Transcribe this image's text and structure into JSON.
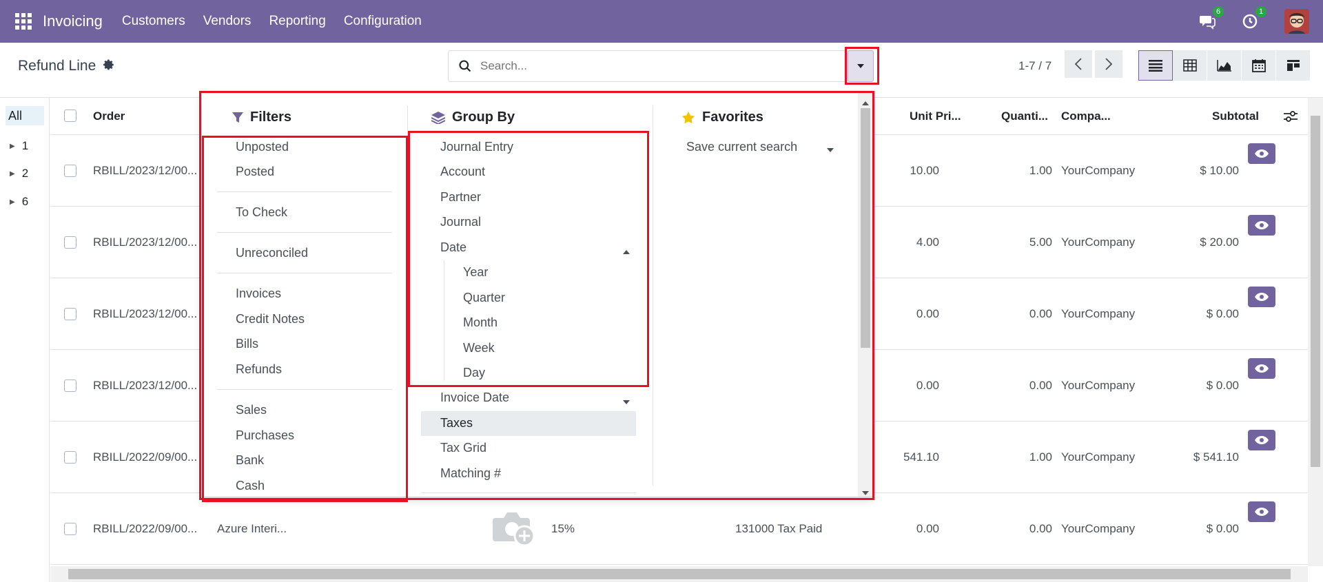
{
  "navbar": {
    "app_name": "Invoicing",
    "menu": [
      "Customers",
      "Vendors",
      "Reporting",
      "Configuration"
    ],
    "messages_badge": "6",
    "activities_badge": "1"
  },
  "control": {
    "title": "Refund Line",
    "search_placeholder": "Search...",
    "pager": "1-7 / 7"
  },
  "groups": {
    "all_label": "All",
    "items": [
      "1",
      "2",
      "6"
    ]
  },
  "table": {
    "headers": {
      "order": "Order",
      "unit_price": "Unit Pri...",
      "quantity": "Quanti...",
      "company": "Compa...",
      "subtotal": "Subtotal"
    },
    "rows": [
      {
        "order": "RBILL/2023/12/00...",
        "partner": "",
        "discount": "",
        "tax": "",
        "unit_price": "10.00",
        "quantity": "1.00",
        "company": "YourCompany",
        "subtotal": "$ 10.00"
      },
      {
        "order": "RBILL/2023/12/00...",
        "partner": "",
        "discount": "",
        "tax": "",
        "unit_price": "4.00",
        "quantity": "5.00",
        "company": "YourCompany",
        "subtotal": "$ 20.00"
      },
      {
        "order": "RBILL/2023/12/00...",
        "partner": "",
        "discount": "",
        "tax": "",
        "unit_price": "0.00",
        "quantity": "0.00",
        "company": "YourCompany",
        "subtotal": "$ 0.00"
      },
      {
        "order": "RBILL/2023/12/00...",
        "partner": "",
        "discount": "",
        "tax": "",
        "unit_price": "0.00",
        "quantity": "0.00",
        "company": "YourCompany",
        "subtotal": "$ 0.00"
      },
      {
        "order": "RBILL/2022/09/00...",
        "partner": "",
        "discount": "",
        "tax": "",
        "unit_price": "541.10",
        "quantity": "1.00",
        "company": "YourCompany",
        "subtotal": "$ 541.10"
      },
      {
        "order": "RBILL/2022/09/00...",
        "partner": "Azure Interi...",
        "discount": "15%",
        "tax": "131000 Tax Paid",
        "unit_price": "0.00",
        "quantity": "0.00",
        "company": "YourCompany",
        "subtotal": "$ 0.00"
      }
    ]
  },
  "dropdown": {
    "filters": {
      "title": "Filters",
      "items": [
        "Unposted",
        "Posted",
        "To Check",
        "Unreconciled",
        "Invoices",
        "Credit Notes",
        "Bills",
        "Refunds",
        "Sales",
        "Purchases",
        "Bank",
        "Cash"
      ]
    },
    "group_by": {
      "title": "Group By",
      "items": [
        "Journal Entry",
        "Account",
        "Partner",
        "Journal",
        "Date"
      ],
      "date_options": [
        "Year",
        "Quarter",
        "Month",
        "Week",
        "Day"
      ],
      "more_items": [
        "Invoice Date",
        "Taxes",
        "Tax Grid",
        "Matching #"
      ]
    },
    "favorites": {
      "title": "Favorites",
      "save_label": "Save current search"
    }
  },
  "colors": {
    "brand": "#71639e",
    "highlight": "#e81123",
    "star": "#f3c200"
  }
}
